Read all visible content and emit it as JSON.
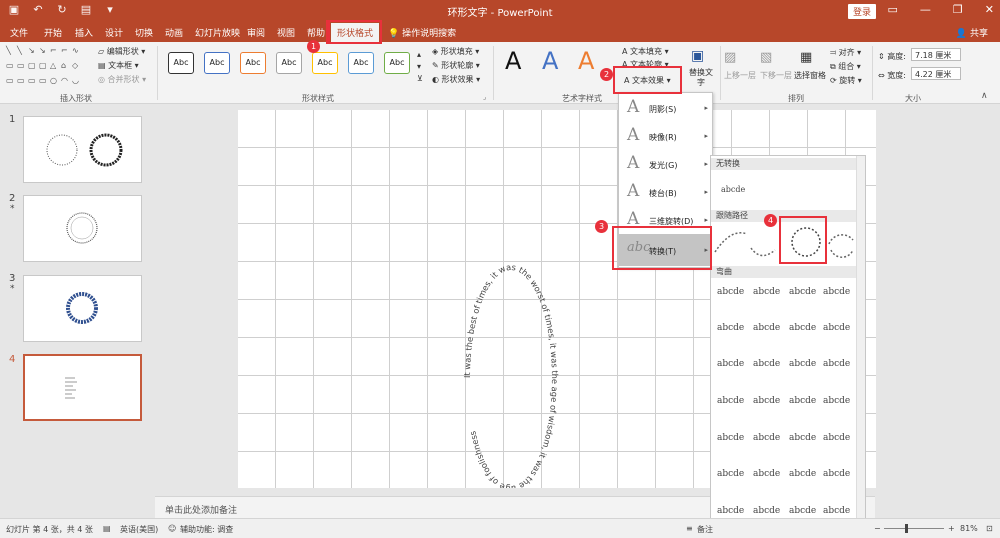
{
  "app": {
    "window_title": "环形文字 - PowerPoint",
    "login_label": "登录",
    "share_label": "共享",
    "tell_me": "操作说明搜索"
  },
  "ribbon_tabs": [
    "文件",
    "开始",
    "插入",
    "设计",
    "切换",
    "动画",
    "幻灯片放映",
    "审阅",
    "视图",
    "帮助",
    "形状格式"
  ],
  "ribbon": {
    "insert_shapes": {
      "label": "插入形状",
      "edit_shape": "编辑形状",
      "textbox": "文本框",
      "merge_shapes": "合并形状"
    },
    "shape_styles": {
      "label": "形状样式",
      "style_sample": "Abc",
      "fill": "形状填充",
      "outline": "形状轮廓",
      "effects": "形状效果"
    },
    "wordart": {
      "label": "艺术字样式",
      "sample": "A",
      "text_fill": "文本填充",
      "text_outline": "文本轮廓",
      "text_effects": "文本效果"
    },
    "accessibility": {
      "label": "替换文字"
    },
    "arrange": {
      "label": "排列",
      "bring_forward": "上移一层",
      "send_backward": "下移一层",
      "selection_pane": "选择窗格",
      "align": "对齐",
      "group": "组合",
      "rotate": "旋转"
    },
    "size": {
      "label": "大小",
      "height_label": "高度:",
      "height_value": "7.18 厘米",
      "width_label": "宽度:",
      "width_value": "4.22 厘米"
    }
  },
  "text_effects_menu": [
    "阴影(S)",
    "映像(R)",
    "发光(G)",
    "棱台(B)",
    "三维旋转(D)",
    "转换(T)"
  ],
  "transform_gallery": {
    "no_transform": "无转换",
    "no_transform_sample": "abcde",
    "follow_path": "跟随路径",
    "warp": "弯曲",
    "sample": "abcde"
  },
  "slide_text": "It was the best of times, it was the worst of times, it was the age of wisdom, it was the age of foolishness",
  "thumbnails": [
    {
      "num": "1",
      "star": ""
    },
    {
      "num": "2",
      "star": "*"
    },
    {
      "num": "3",
      "star": "*"
    },
    {
      "num": "4",
      "star": ""
    }
  ],
  "notes_placeholder": "单击此处添加备注",
  "status": {
    "slide_info": "幻灯片 第 4 张，共 4 张",
    "language": "英语(美国)",
    "accessibility": "辅助功能: 调查",
    "notes": "备注",
    "zoom": "81%"
  },
  "badges": [
    "1",
    "2",
    "3",
    "4"
  ],
  "colors": {
    "brand": "#b7472a",
    "highlight": "#e8313b",
    "blue_wordart": "#4472c4",
    "orange_wordart": "#ed7d31"
  }
}
